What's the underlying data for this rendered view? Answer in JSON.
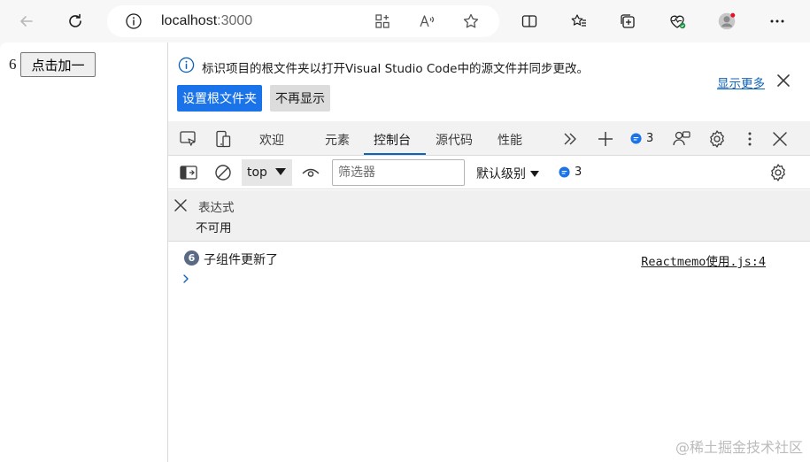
{
  "browser": {
    "url_host": "localhost",
    "url_port": ":3000"
  },
  "page": {
    "counter_value": "6",
    "increment_button_label": "点击加一"
  },
  "devtools": {
    "banner": {
      "message": "标识项目的根文件夹以打开Visual Studio Code中的源文件并同步更改。",
      "show_more": "显示更多",
      "set_root_button": "设置根文件夹",
      "dont_show_button": "不再显示"
    },
    "tabs": [
      {
        "label": "欢迎",
        "active": false
      },
      {
        "label": "元素",
        "active": false
      },
      {
        "label": "控制台",
        "active": true
      },
      {
        "label": "源代码",
        "active": false
      },
      {
        "label": "性能",
        "active": false
      }
    ],
    "issues_count": "3",
    "console": {
      "context": "top",
      "filter_placeholder": "筛选器",
      "levels": "默认级别",
      "issues_count": "3"
    },
    "live_expression": {
      "label": "表达式",
      "value": "不可用"
    },
    "log": {
      "repeat_count": "6",
      "message": "子组件更新了",
      "source": "Reactmemo使用.js:4"
    }
  },
  "watermark": "@稀土掘金技术社区",
  "colors": {
    "accent": "#0f63b8",
    "primary_button": "#1a73e8"
  }
}
